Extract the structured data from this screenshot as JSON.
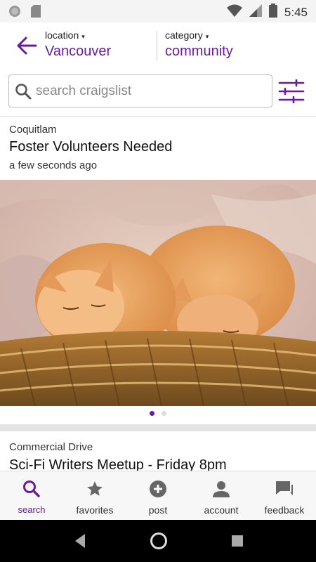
{
  "status_bar": {
    "time": "5:45",
    "left_icons": [
      "circle-notification-icon",
      "sd-card-icon"
    ],
    "right_icons": [
      "wifi-icon",
      "signal-icon",
      "battery-icon"
    ]
  },
  "header": {
    "location_label": "location",
    "location_value": "Vancouver",
    "category_label": "category",
    "category_value": "community",
    "caret": "▾"
  },
  "search": {
    "placeholder": "search craigslist",
    "value": ""
  },
  "postings": [
    {
      "location": "Coquitlam",
      "title": "Foster Volunteers Needed",
      "time": "a few seconds ago",
      "image": "two orange kittens sleeping in a wicker basket",
      "image_count": 2,
      "image_index": 0
    },
    {
      "location": "Commercial Drive",
      "title": "Sci-Fi Writers Meetup - Friday 8pm"
    }
  ],
  "bottom_nav": [
    {
      "label": "search",
      "icon": "search-icon",
      "active": true
    },
    {
      "label": "favorites",
      "icon": "star-icon",
      "active": false
    },
    {
      "label": "post",
      "icon": "add-circle-icon",
      "active": false
    },
    {
      "label": "account",
      "icon": "person-icon",
      "active": false
    },
    {
      "label": "feedback",
      "icon": "chat-icon",
      "active": false
    }
  ],
  "colors": {
    "accent": "#6a1b9a",
    "nav_bar": "#f7f7f7",
    "separator": "#e4e4e4"
  }
}
